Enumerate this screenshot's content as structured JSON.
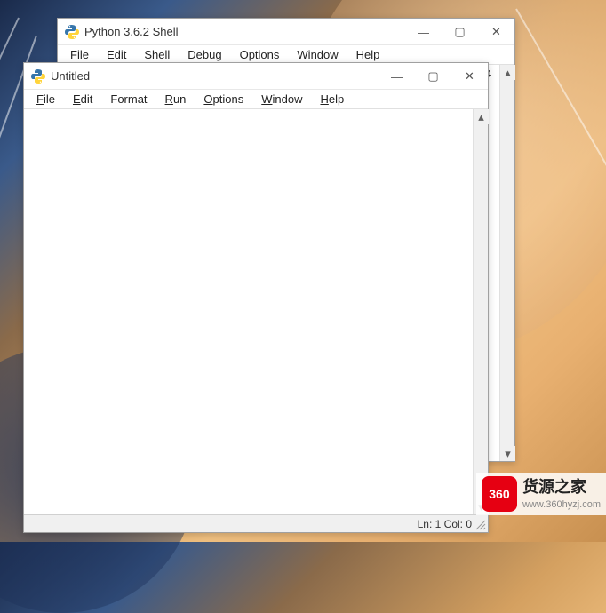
{
  "shell_window": {
    "title": "Python 3.6.2 Shell",
    "menus": [
      "File",
      "Edit",
      "Shell",
      "Debug",
      "Options",
      "Window",
      "Help"
    ],
    "content_partial": "Python 3.6.2 (v3.6.2:5fd33b5, Jul  8 2017, 04:57:36) [MSC v.1900 64 bit (AMD64)]",
    "win_controls": {
      "minimize": "—",
      "maximize": "▢",
      "close": "✕"
    }
  },
  "editor_window": {
    "title": "Untitled",
    "menus": [
      {
        "label": "File",
        "underline": "F"
      },
      {
        "label": "Edit",
        "underline": "E"
      },
      {
        "label": "Format",
        "underline": "F"
      },
      {
        "label": "Run",
        "underline": "R"
      },
      {
        "label": "Options",
        "underline": "O"
      },
      {
        "label": "Window",
        "underline": "W"
      },
      {
        "label": "Help",
        "underline": "H"
      }
    ],
    "content": "",
    "status": "Ln: 1  Col: 0",
    "win_controls": {
      "minimize": "—",
      "maximize": "▢",
      "close": "✕"
    }
  },
  "watermark": {
    "badge": "360",
    "title": "货源之家",
    "url": "www.360hyzj.com"
  }
}
